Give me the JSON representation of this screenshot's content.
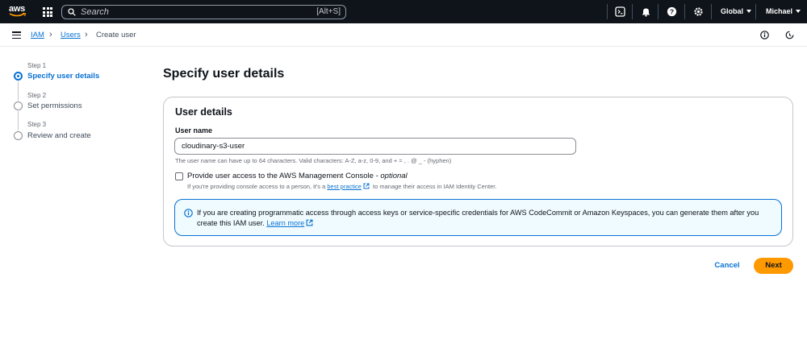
{
  "topnav": {
    "logo_text": "aws",
    "search_placeholder": "Search",
    "search_shortcut": "[Alt+S]",
    "region_label": "Global",
    "account_label": "Michael"
  },
  "breadcrumb": {
    "items": [
      {
        "label": "IAM",
        "link": true
      },
      {
        "label": "Users",
        "link": true
      },
      {
        "label": "Create user",
        "link": false
      }
    ]
  },
  "wizard": {
    "steps": [
      {
        "step": "Step 1",
        "title": "Specify user details",
        "active": true
      },
      {
        "step": "Step 2",
        "title": "Set permissions",
        "active": false
      },
      {
        "step": "Step 3",
        "title": "Review and create",
        "active": false
      }
    ]
  },
  "main": {
    "page_title": "Specify user details",
    "panel_title": "User details",
    "user_name_label": "User name",
    "user_name_value": "cloudinary-s3-user",
    "user_name_hint": "The user name can have up to 64 characters. Valid characters: A-Z, a-z, 0-9, and + = , . @ _ - (hyphen)",
    "console_access_label": "Provide user access to the AWS Management Console -",
    "console_access_optional": "optional",
    "console_access_checked": false,
    "console_desc_prefix": "If you're providing console access to a person, it's a",
    "console_desc_link": "best practice",
    "console_desc_suffix": "to manage their access in IAM Identity Center.",
    "alert_text": "If you are creating programmatic access through access keys or service-specific credentials for AWS CodeCommit or Amazon Keyspaces, you can generate them after you create this IAM user.",
    "alert_link": "Learn more"
  },
  "footer": {
    "cancel_label": "Cancel",
    "next_label": "Next"
  },
  "colors": {
    "nav_bg": "#0f141a",
    "link": "#0972d3",
    "primary_button": "#ff9900",
    "alert_bg": "#f0fbff"
  }
}
